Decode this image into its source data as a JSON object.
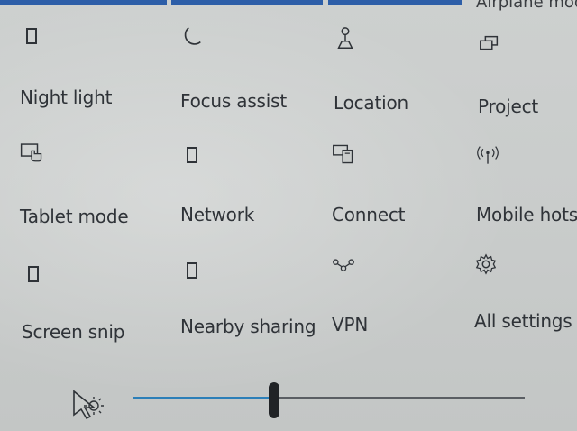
{
  "partial_title": "Airplane mode",
  "brightness": {
    "value_percent": 36
  },
  "tiles": [
    {
      "label": "Night light",
      "icon": "night-light-icon"
    },
    {
      "label": "Focus assist",
      "icon": "moon-icon"
    },
    {
      "label": "Location",
      "icon": "location-icon"
    },
    {
      "label": "Project",
      "icon": "project-icon"
    },
    {
      "label": "Tablet mode",
      "icon": "tablet-mode-icon"
    },
    {
      "label": "Network",
      "icon": "network-icon"
    },
    {
      "label": "Connect",
      "icon": "connect-icon"
    },
    {
      "label": "Mobile hotsp",
      "icon": "mobile-hotspot-icon"
    },
    {
      "label": "Screen snip",
      "icon": "screen-snip-icon"
    },
    {
      "label": "Nearby sharing",
      "icon": "nearby-sharing-icon"
    },
    {
      "label": "VPN",
      "icon": "vpn-icon"
    },
    {
      "label": "All settings",
      "icon": "gear-icon"
    }
  ]
}
